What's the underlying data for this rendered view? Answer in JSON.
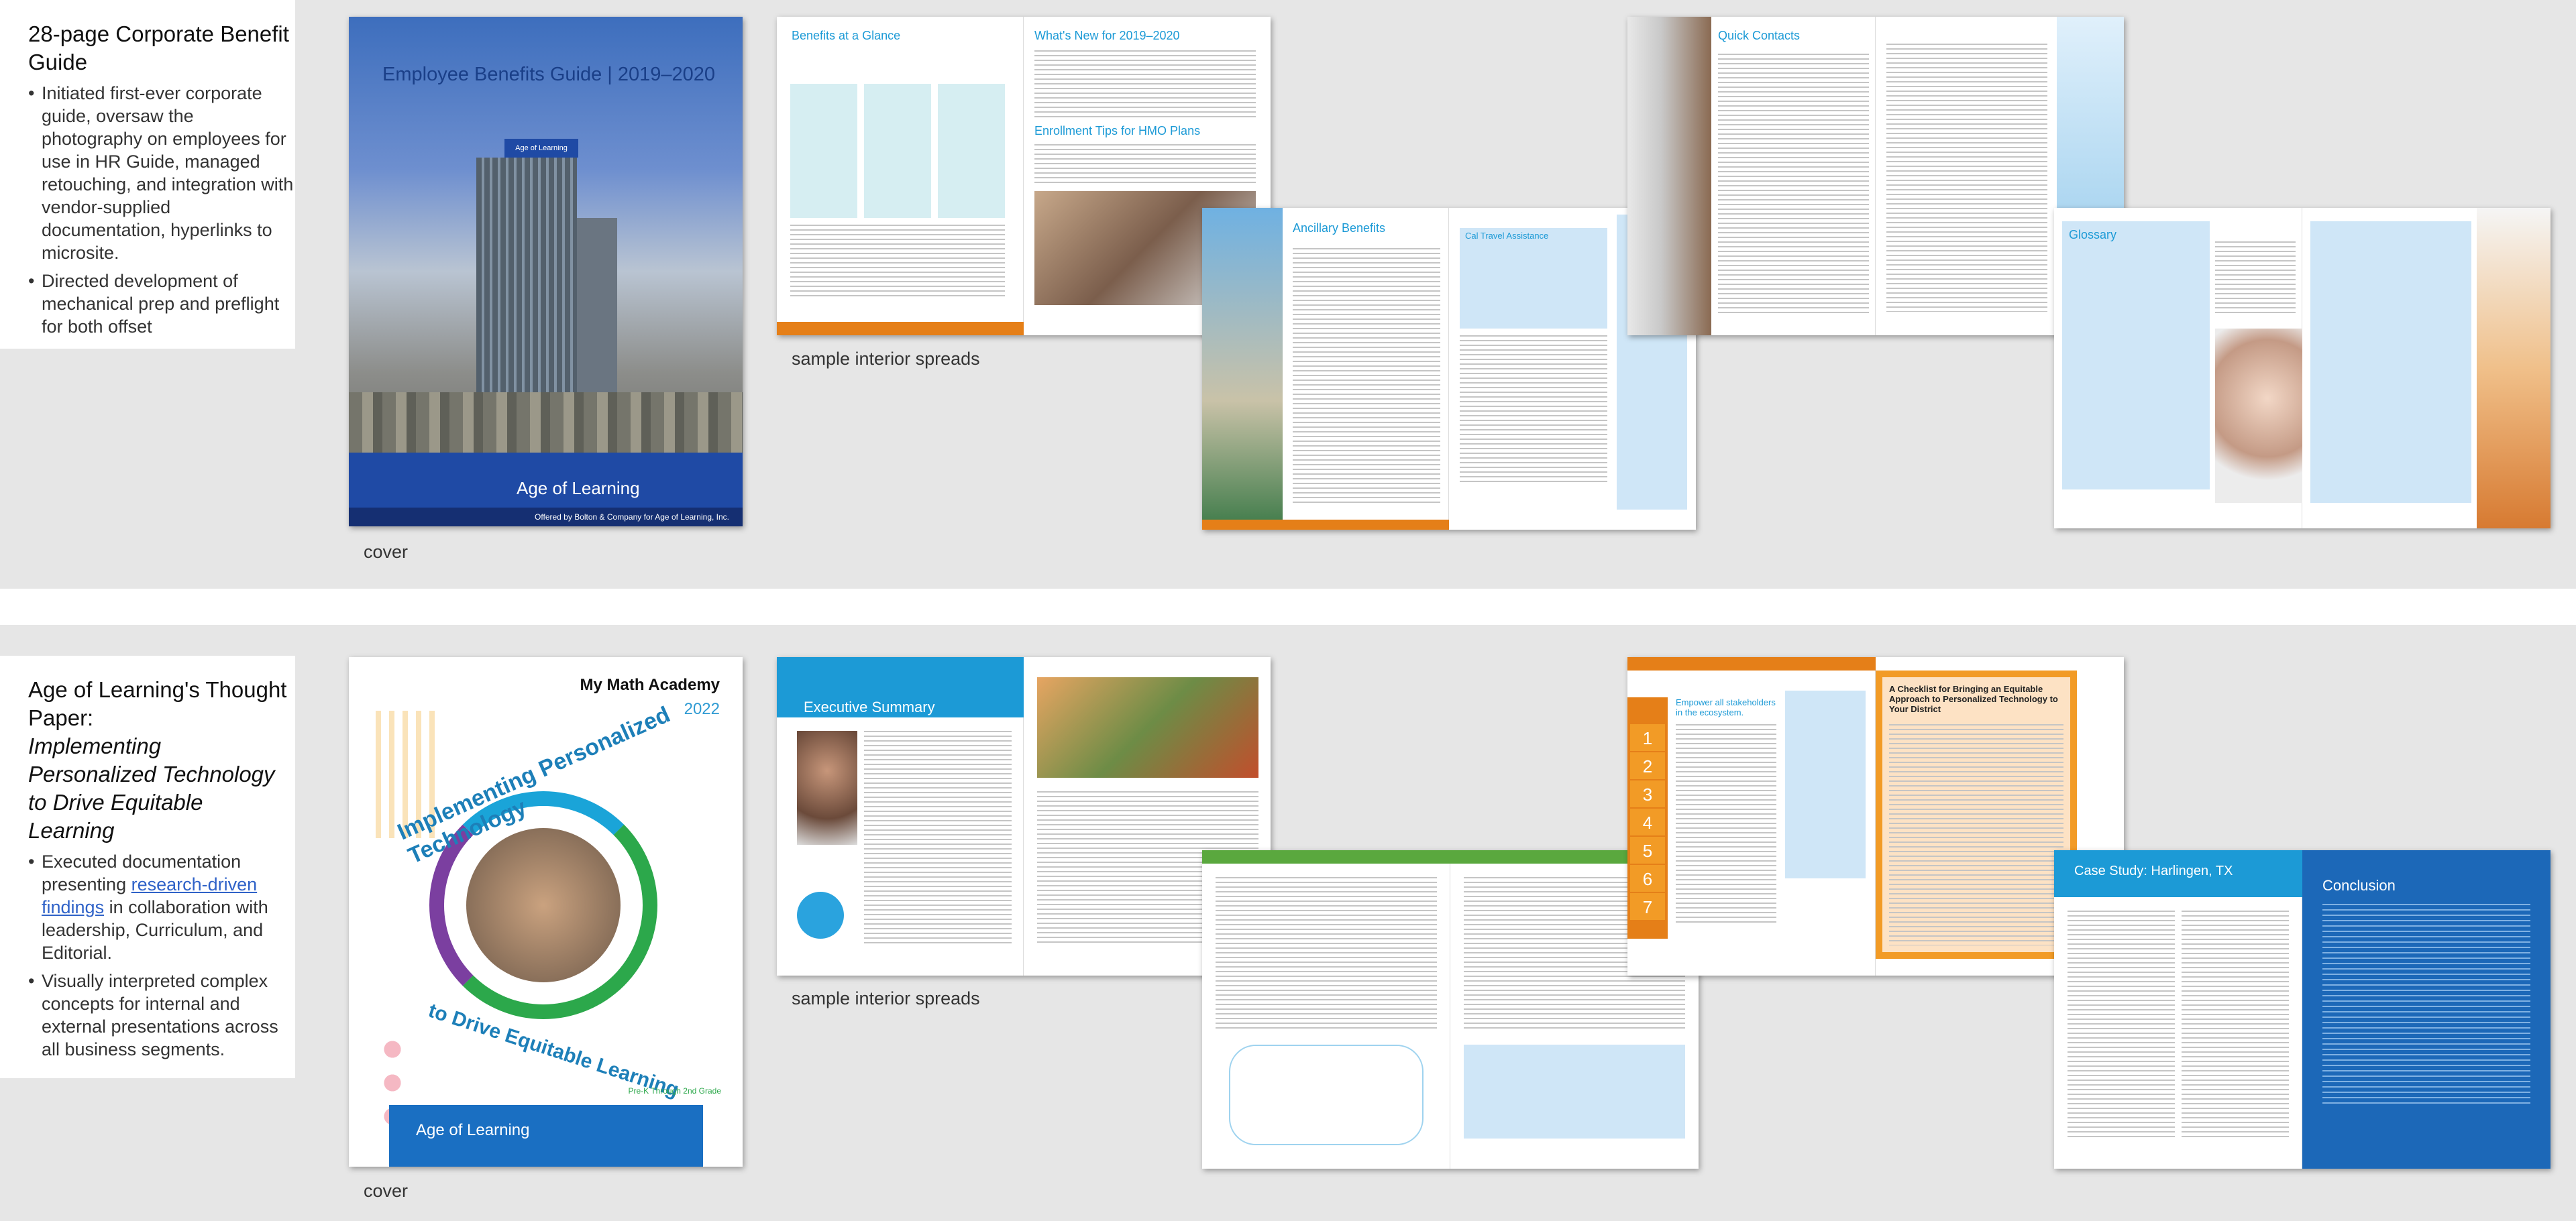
{
  "top": {
    "heading": "28-page Corporate Benefit Guide",
    "bullets": [
      "Initiated first-ever corporate guide, oversaw the photography on employees for use in HR Guide, managed retouching, and integration with vendor-supplied documentation, hyperlinks to microsite.",
      "Directed development of mechanical prep and preflight for both offset"
    ],
    "cover_caption": "cover",
    "spreads_caption": "sample interior spreads",
    "cover": {
      "title": "Employee Benefits Guide | 2019–2020",
      "sign": "Age of Learning",
      "brand": "Age of Learning",
      "offered": "Offered by Bolton & Company for Age of Learning, Inc."
    },
    "spreads": {
      "s1_left_title": "Benefits at a Glance",
      "s1_right_title": "What's New for 2019–2020",
      "s1_right_sub": "Enrollment Tips for HMO Plans",
      "s2_left_title": "Ancillary Benefits",
      "s2_right_title": "Cal Travel Assistance",
      "s3_title": "Quick Contacts",
      "s4_title": "Glossary"
    }
  },
  "bottom": {
    "heading_line1": "Age of Learning's Thought Paper:",
    "heading_italic": "Implementing Personalized Technology to Drive Equitable Learning",
    "bullet1_pre": "Executed documentation presenting ",
    "bullet1_link": "research-driven findings",
    "bullet1_post": " in collaboration with leadership, Curriculum, and Editorial.",
    "bullet2": "Visually interpreted complex concepts for internal and external presentations across all business segments.",
    "cover_caption": "cover",
    "spreads_caption": "sample interior spreads",
    "cover": {
      "logo": "My Math Academy",
      "year": "2022",
      "arc_top": "Implementing Personalized Technology",
      "arc_bottom": "to Drive Equitable Learning",
      "grade": "Pre-K Through 2nd Grade",
      "brand": "Age of Learning"
    },
    "spreads": {
      "s1_title": "Executive Summary",
      "s3_title": "A Checklist for Bringing an Equitable Approach to Personalized Technology to Your District",
      "s3_left": "Empower all stakeholders in the ecosystem.",
      "numbers": [
        "1",
        "2",
        "3",
        "4",
        "5",
        "6",
        "7"
      ],
      "s4_left_title": "Case Study: Harlingen, TX",
      "s4_right_title": "Conclusion"
    }
  },
  "colors": {
    "accent_blue": "#1c9ad6",
    "brand_blue": "#1f4aa5",
    "orange": "#e57f18",
    "green": "#2ca84b",
    "link": "#2f62c8"
  }
}
